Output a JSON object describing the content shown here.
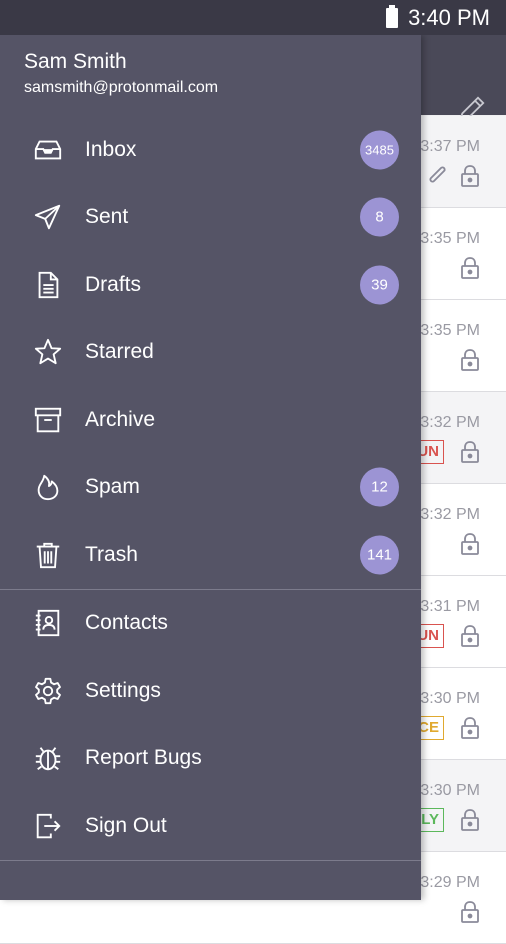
{
  "status_bar": {
    "time": "3:40 PM"
  },
  "drawer": {
    "user_name": "Sam Smith",
    "user_email": "samsmith@protonmail.com",
    "menu_primary": [
      {
        "label": "Inbox",
        "icon": "inbox-icon",
        "badge": "3485"
      },
      {
        "label": "Sent",
        "icon": "send-icon",
        "badge": "8"
      },
      {
        "label": "Drafts",
        "icon": "draft-icon",
        "badge": "39"
      },
      {
        "label": "Starred",
        "icon": "star-icon",
        "badge": ""
      },
      {
        "label": "Archive",
        "icon": "archive-icon",
        "badge": ""
      },
      {
        "label": "Spam",
        "icon": "flame-icon",
        "badge": "12"
      },
      {
        "label": "Trash",
        "icon": "trash-icon",
        "badge": "141"
      }
    ],
    "menu_secondary": [
      {
        "label": "Contacts",
        "icon": "contacts-icon"
      },
      {
        "label": "Settings",
        "icon": "gear-icon"
      },
      {
        "label": "Report Bugs",
        "icon": "bug-icon"
      },
      {
        "label": "Sign Out",
        "icon": "sign-out-icon"
      }
    ]
  },
  "background_list": {
    "rows": [
      {
        "time": "3:37 PM",
        "tag": "",
        "clip": true,
        "read": true
      },
      {
        "time": "3:35 PM",
        "tag": "",
        "clip": false,
        "read": false
      },
      {
        "time": "3:35 PM",
        "tag": "",
        "clip": false,
        "read": false
      },
      {
        "time": "3:32 PM",
        "tag": "UN",
        "tag_color": "#d9534f",
        "clip": false,
        "read": true
      },
      {
        "time": "3:32 PM",
        "tag": "",
        "clip": false,
        "read": false
      },
      {
        "time": "3:31 PM",
        "tag": "UN",
        "tag_color": "#d9534f",
        "clip": false,
        "read": false
      },
      {
        "time": "3:30 PM",
        "tag": "CE",
        "tag_color": "#e0a92f",
        "clip": false,
        "read": false
      },
      {
        "time": "3:30 PM",
        "tag": "LY",
        "tag_color": "#5cb85c",
        "clip": false,
        "read": true
      },
      {
        "time": "3:29 PM",
        "tag": "",
        "clip": false,
        "read": false
      }
    ]
  },
  "colors": {
    "drawer_bg": "#555466",
    "badge_bg": "#9c94d4",
    "app_bar": "#4a4958"
  }
}
